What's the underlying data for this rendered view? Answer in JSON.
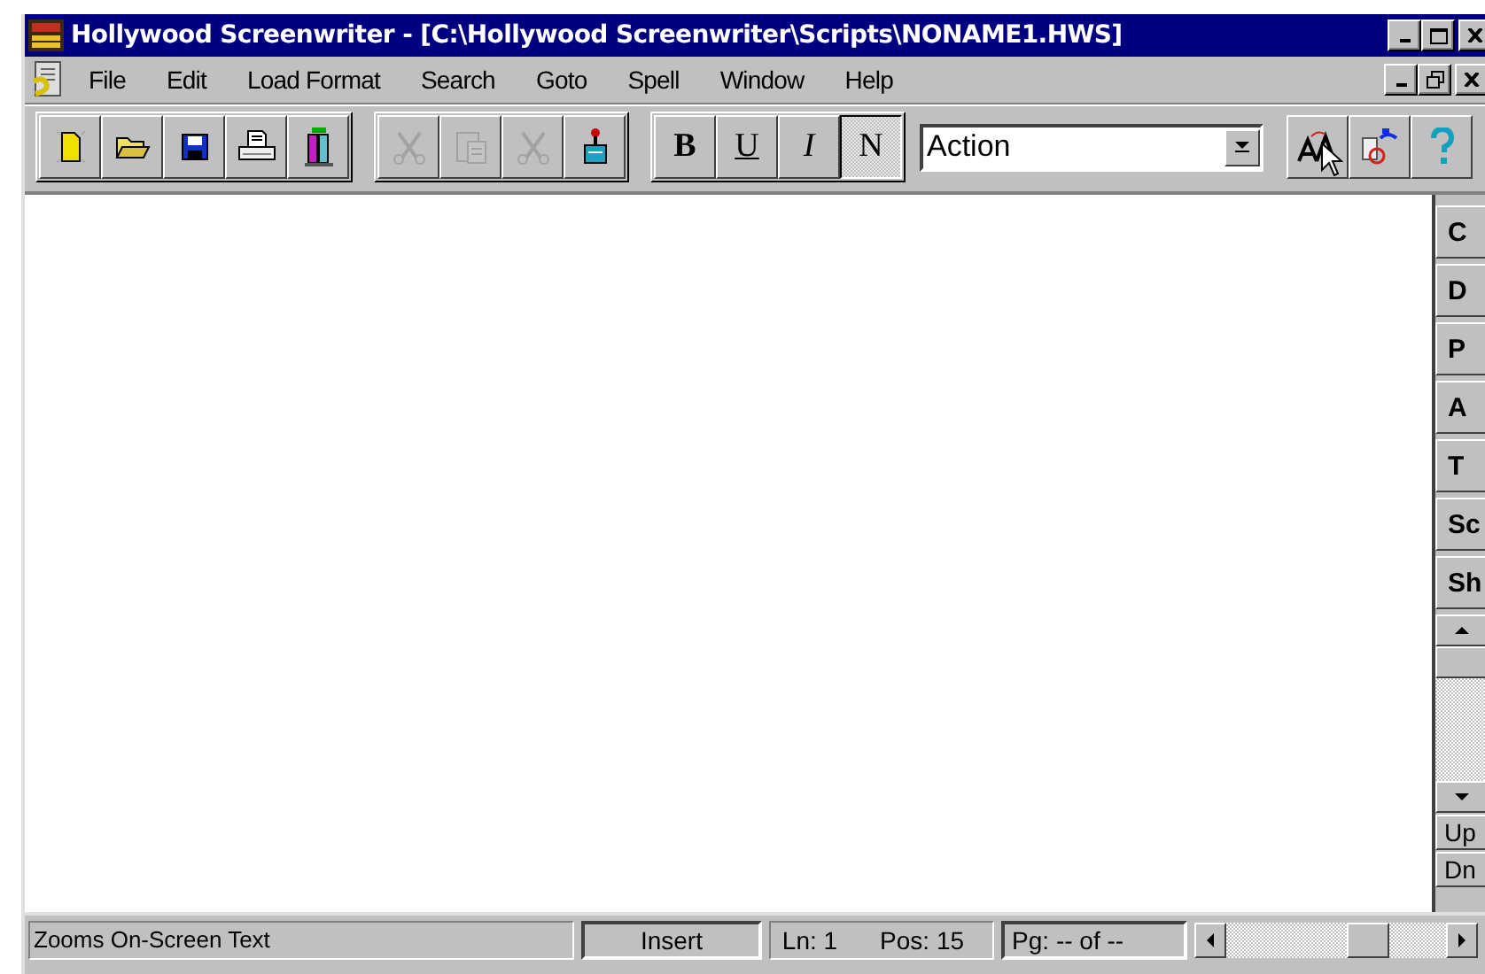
{
  "window": {
    "title": "Hollywood Screenwriter - [C:\\Hollywood Screenwriter\\Scripts\\NONAME1.HWS]"
  },
  "menu": [
    "File",
    "Edit",
    "Load Format",
    "Search",
    "Goto",
    "Spell",
    "Window",
    "Help"
  ],
  "toolbar": {
    "groups": [
      [
        {
          "kind": "new",
          "disabled": false
        },
        {
          "kind": "open",
          "disabled": false
        },
        {
          "kind": "save",
          "disabled": false
        },
        {
          "kind": "print",
          "disabled": false
        },
        {
          "kind": "tool",
          "disabled": false
        }
      ],
      [
        {
          "kind": "cut",
          "disabled": true
        },
        {
          "kind": "paste",
          "disabled": true
        },
        {
          "kind": "cut",
          "disabled": true
        },
        {
          "kind": "ink",
          "disabled": false
        }
      ]
    ],
    "format_buttons": [
      {
        "label": "B",
        "kind": "bold",
        "selected": false
      },
      {
        "label": "U",
        "kind": "underline",
        "selected": false
      },
      {
        "label": "I",
        "kind": "italic",
        "selected": false
      },
      {
        "label": "N",
        "kind": "normal",
        "selected": true
      }
    ],
    "element_style": {
      "value": "Action"
    }
  },
  "side_panel": {
    "buttons": [
      "C",
      "D",
      "P",
      "A",
      "T",
      "Sc",
      "Sh"
    ],
    "page_buttons": [
      "Up",
      "Dn"
    ]
  },
  "status_bar": {
    "hint": "Zooms On-Screen Text",
    "mode": "Insert",
    "line": "Ln: 1",
    "position": "Pos: 15",
    "page": "Pg: -- of --"
  }
}
